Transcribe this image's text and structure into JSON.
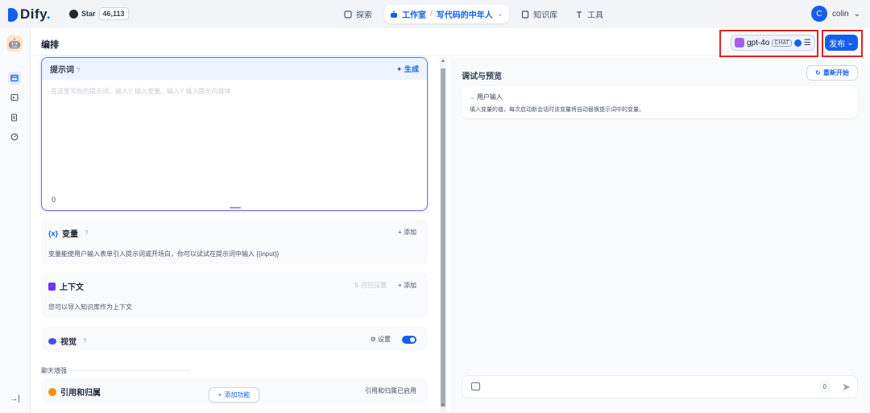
{
  "colors": {
    "accent": "#155eef",
    "highlight_box": "#e32222",
    "prompt_border": "#6c6cf5"
  },
  "brand": {
    "logo_text": "Dify",
    "logo_dot": ".",
    "star_label": "Star",
    "star_count": "46,113"
  },
  "nav": {
    "explore": "探索",
    "studio": "工作室",
    "separator": "/",
    "current_app": "写代码的中年人",
    "knowledge": "知识库",
    "tools": "工具"
  },
  "user": {
    "avatar_letter": "C",
    "name": "colin"
  },
  "header": {
    "title": "编排",
    "model_name": "gpt-4o",
    "model_mode": "CHAT",
    "publish_label": "发布"
  },
  "prompt": {
    "title": "提示词",
    "help": "?",
    "generate_label": "生成",
    "placeholder": "在这里写你的提示词，输入'{' 插入变量、输入'/' 插入提示内容块",
    "char_count": "0"
  },
  "variables": {
    "icon": "{x}",
    "title": "变量",
    "add_label": "添加",
    "description": "变量能使用户输入表单引入提示词或开场白，你可以试试在提示词中输入 {{input}}"
  },
  "context": {
    "title": "上下文",
    "retrieval_label": "召回设置",
    "add_label": "添加",
    "description": "您可以导入知识库作为上下文"
  },
  "vision": {
    "title": "视觉",
    "settings_label": "设置",
    "enabled": true
  },
  "chat_enhance": {
    "section_label": "聊天增强",
    "citation_title": "引用和归属",
    "citation_status": "引用和归属已启用",
    "add_feature_label": "添加功能"
  },
  "debug": {
    "title": "调试与预览",
    "restart_label": "重新开始",
    "user_input_title": "用户输入",
    "user_input_desc": "填入变量的值，每次启动新会话时该变量将自动替换提示词中的变量。",
    "chat_count": "0"
  }
}
